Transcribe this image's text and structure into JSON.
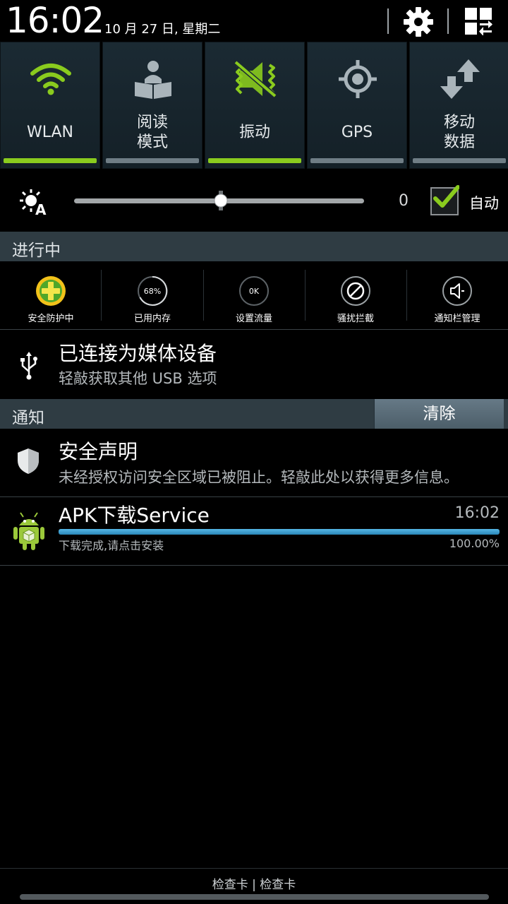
{
  "status": {
    "time": "16:02",
    "date": "10 月 27 日, 星期二"
  },
  "toggles": [
    {
      "label1": "WLAN",
      "label2": "",
      "icon": "wifi-icon",
      "on": true
    },
    {
      "label1": "阅读",
      "label2": "模式",
      "icon": "reading-mode-icon",
      "on": false
    },
    {
      "label1": "振动",
      "label2": "",
      "icon": "vibrate-icon",
      "on": true
    },
    {
      "label1": "GPS",
      "label2": "",
      "icon": "gps-icon",
      "on": false
    },
    {
      "label1": "移动",
      "label2": "数据",
      "icon": "mobile-data-icon",
      "on": false
    }
  ],
  "brightness": {
    "value": "0",
    "auto_label": "自动",
    "auto_checked": true,
    "level": 0.5
  },
  "running": {
    "title": "进行中",
    "tools": [
      {
        "label": "安全防护中",
        "icon": "360-security-icon",
        "badge": ""
      },
      {
        "label": "已用内存",
        "icon": "memory-icon",
        "badge": "68%"
      },
      {
        "label": "设置流量",
        "icon": "traffic-icon",
        "badge": "0K"
      },
      {
        "label": "骚扰拦截",
        "icon": "block-icon",
        "badge": ""
      },
      {
        "label": "通知栏管理",
        "icon": "speaker-icon",
        "badge": ""
      }
    ]
  },
  "usb": {
    "title": "已连接为媒体设备",
    "subtitle": "轻敲获取其他 USB 选项"
  },
  "notifications": {
    "title": "通知",
    "clear_label": "清除",
    "items": [
      {
        "title": "安全声明",
        "text": "未经授权访问安全区域已被阻止。轻敲此处以获得更多信息。"
      },
      {
        "title": "APK下载Service",
        "time": "16:02",
        "text": "下载完成,请点击安装",
        "percent": "100.00%",
        "progress": 1.0
      }
    ]
  },
  "carrier": "检查卡 | 检查卡",
  "colors": {
    "accent_green": "#8acb1e",
    "toggle_off": "#6f7d85",
    "section_bg": "#2f3c43",
    "progress_blue": "#3a9fd5"
  }
}
